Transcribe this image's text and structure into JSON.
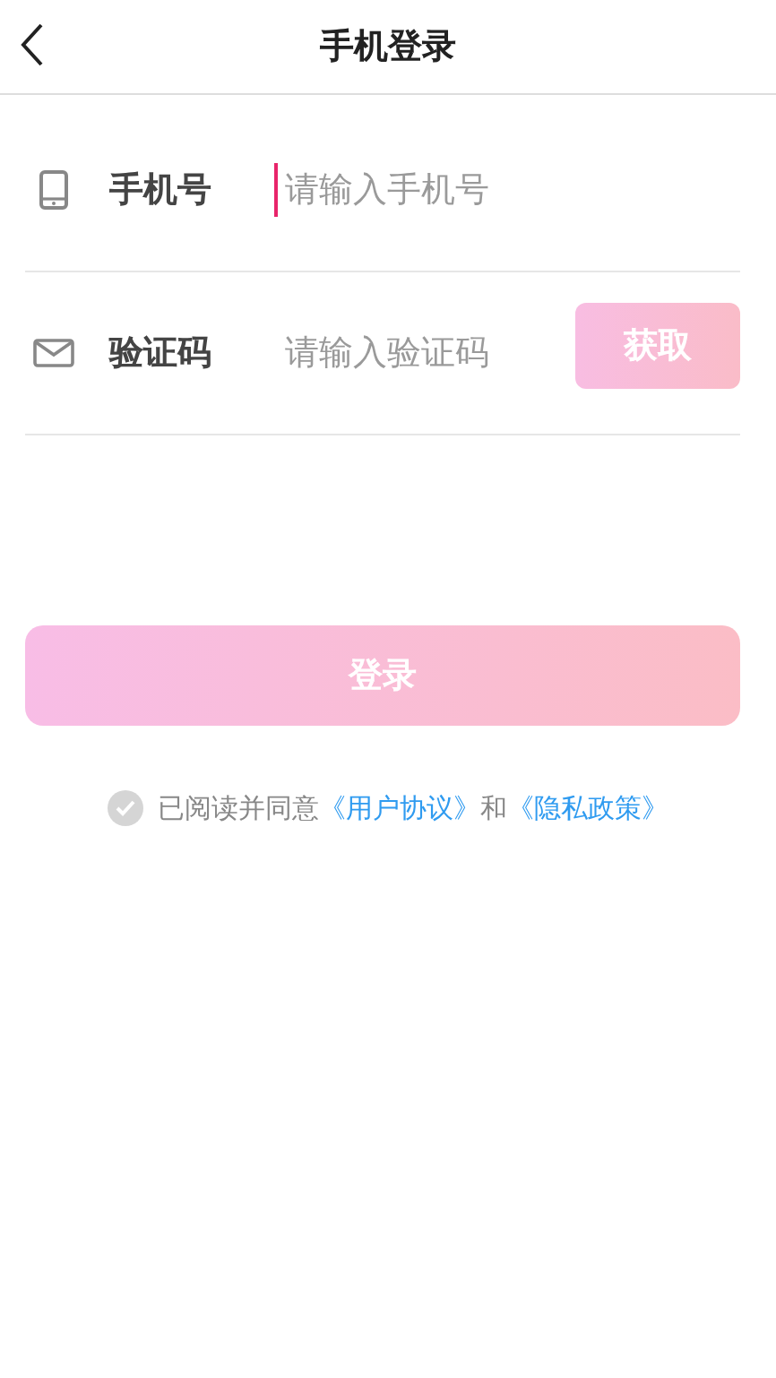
{
  "header": {
    "title": "手机登录"
  },
  "fields": [
    {
      "kind": "phone",
      "label": "手机号",
      "placeholder": "请输入手机号",
      "focused": true
    },
    {
      "kind": "code",
      "label": "验证码",
      "placeholder": "请输入验证码",
      "focused": false,
      "button": "获取"
    }
  ],
  "login_button": "登录",
  "agreement": {
    "checked": false,
    "parts": [
      {
        "kind": "text",
        "text": "已阅读并同意"
      },
      {
        "kind": "link",
        "text": "《用户协议》"
      },
      {
        "kind": "text",
        "text": "和"
      },
      {
        "kind": "link",
        "text": "《隐私政策》"
      }
    ]
  }
}
